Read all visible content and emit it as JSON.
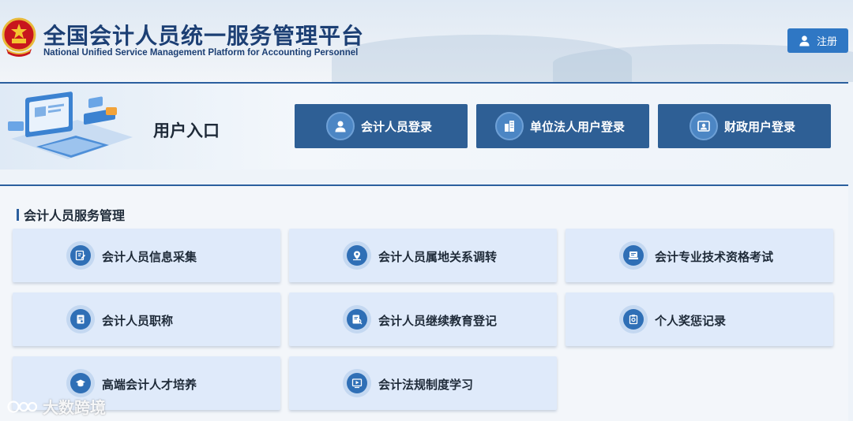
{
  "header": {
    "title_cn": "全国会计人员统一服务管理平台",
    "title_en": "National Unified Service Management Platform for Accounting Personnel",
    "emblem_icon": "national-emblem-icon",
    "register_label": "注册",
    "register_icon": "user-icon"
  },
  "entry": {
    "title": "用户入口",
    "buttons": [
      {
        "label": "会计人员登录",
        "icon": "user-icon"
      },
      {
        "label": "单位法人用户登录",
        "icon": "building-icon"
      },
      {
        "label": "财政用户登录",
        "icon": "id-card-icon"
      }
    ]
  },
  "services": {
    "title": "会计人员服务管理",
    "cards": [
      {
        "label": "会计人员信息采集",
        "icon": "edit-form-icon"
      },
      {
        "label": "会计人员属地关系调转",
        "icon": "location-icon"
      },
      {
        "label": "会计专业技术资格考试",
        "icon": "exam-icon"
      },
      {
        "label": "会计人员职称",
        "icon": "certificate-icon"
      },
      {
        "label": "会计人员继续教育登记",
        "icon": "education-record-icon"
      },
      {
        "label": "个人奖惩记录",
        "icon": "clipboard-icon"
      },
      {
        "label": "高端会计人才培养",
        "icon": "graduation-cap-icon"
      },
      {
        "label": "会计法规制度学习",
        "icon": "video-play-icon"
      }
    ]
  },
  "watermark": "大数跨境",
  "colors": {
    "primary_dark": "#2e5f95",
    "accent": "#2f77c4",
    "card_bg": "#dfeafa",
    "title_blue": "#1c3f74"
  }
}
